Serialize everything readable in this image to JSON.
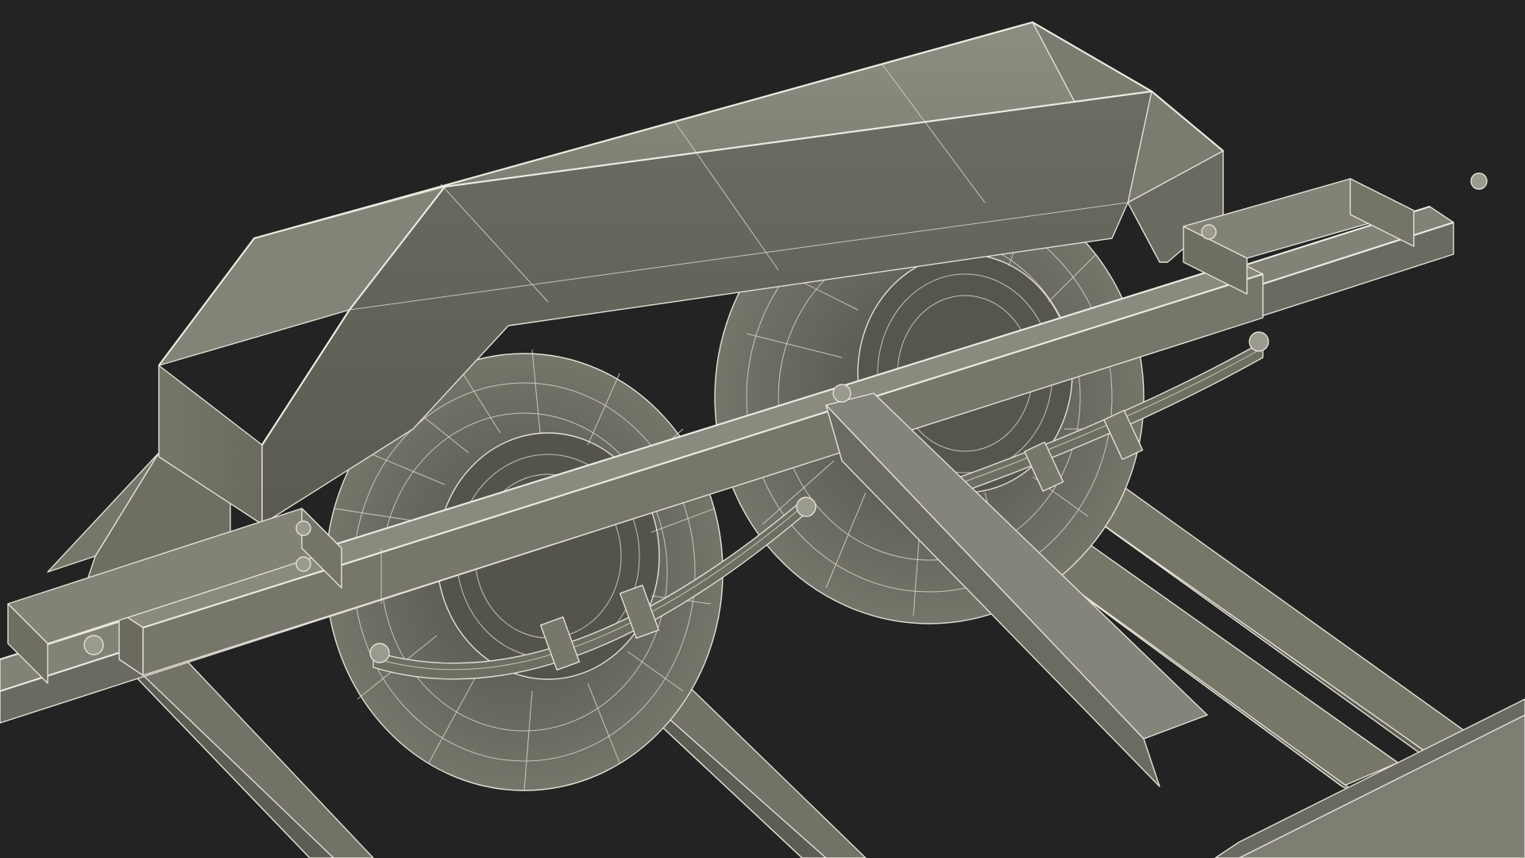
{
  "scene": {
    "background_color": "#232323",
    "surface_color": "#7f7f74",
    "wire_color": "#e4e2d8"
  }
}
